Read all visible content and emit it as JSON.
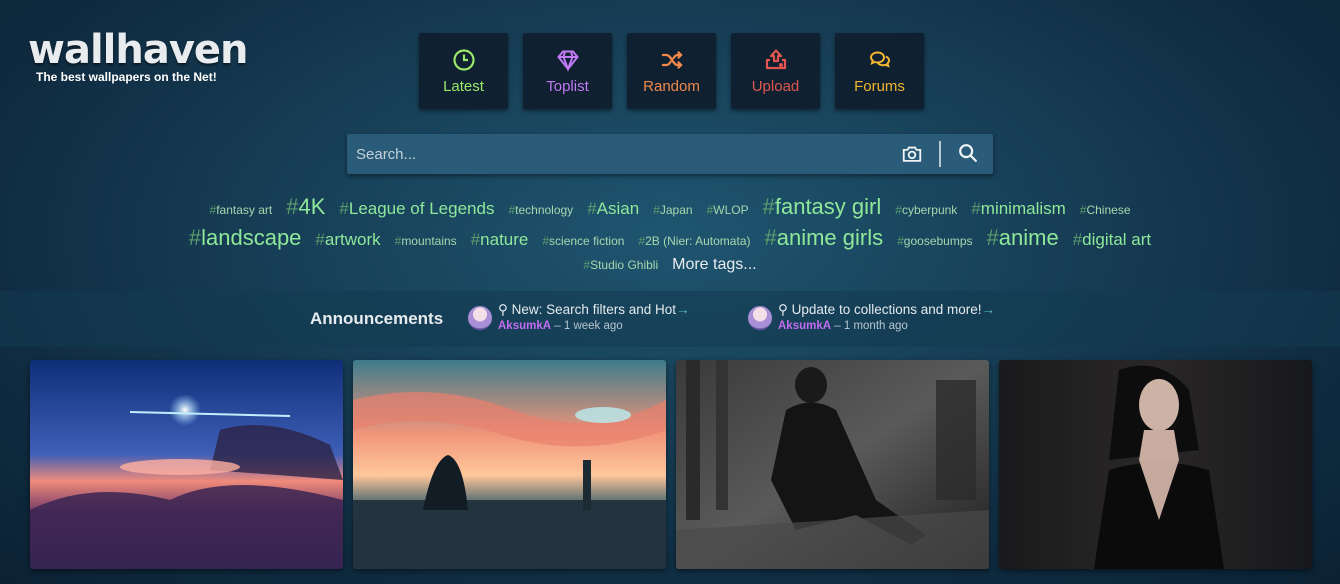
{
  "logo": {
    "title": "wallhaven",
    "tagline": "The best wallpapers on the Net!"
  },
  "nav": [
    {
      "label": "Latest",
      "icon": "clock-icon",
      "color": "#9be76a"
    },
    {
      "label": "Toplist",
      "icon": "diamond-icon",
      "color": "#c07af5"
    },
    {
      "label": "Random",
      "icon": "shuffle-icon",
      "color": "#f2894a"
    },
    {
      "label": "Upload",
      "icon": "upload-icon",
      "color": "#e0564f"
    },
    {
      "label": "Forums",
      "icon": "chat-icon",
      "color": "#f2b630"
    }
  ],
  "search": {
    "placeholder": "Search..."
  },
  "tags": {
    "hash": "#",
    "row1": [
      "fantasy art",
      "4K",
      "League of Legends",
      "technology",
      "Asian",
      "Japan",
      "WLOP",
      "fantasy girl",
      "cyberpunk",
      "minimalism",
      "Chinese"
    ],
    "row2": [
      "landscape",
      "artwork",
      "mountains",
      "nature",
      "science fiction",
      "2B (Nier: Automata)",
      "anime girls",
      "goosebumps",
      "anime",
      "digital art"
    ],
    "row3": [
      "Studio Ghibli"
    ],
    "more": "More tags..."
  },
  "announcements": {
    "title": "Announcements",
    "items": [
      {
        "text": "New: Search filters and Hot",
        "user": "AksumkA",
        "time": "– 1 week ago"
      },
      {
        "text": "Update to collections and more!",
        "user": "AksumkA",
        "time": "– 1 month ago"
      }
    ],
    "arrow": "→",
    "pin": "⚲"
  },
  "thumbnails": [
    "thumbnail-sky-sunset",
    "thumbnail-anime-sunset-city",
    "thumbnail-dark-warrior-woman",
    "thumbnail-portrait-woman"
  ]
}
